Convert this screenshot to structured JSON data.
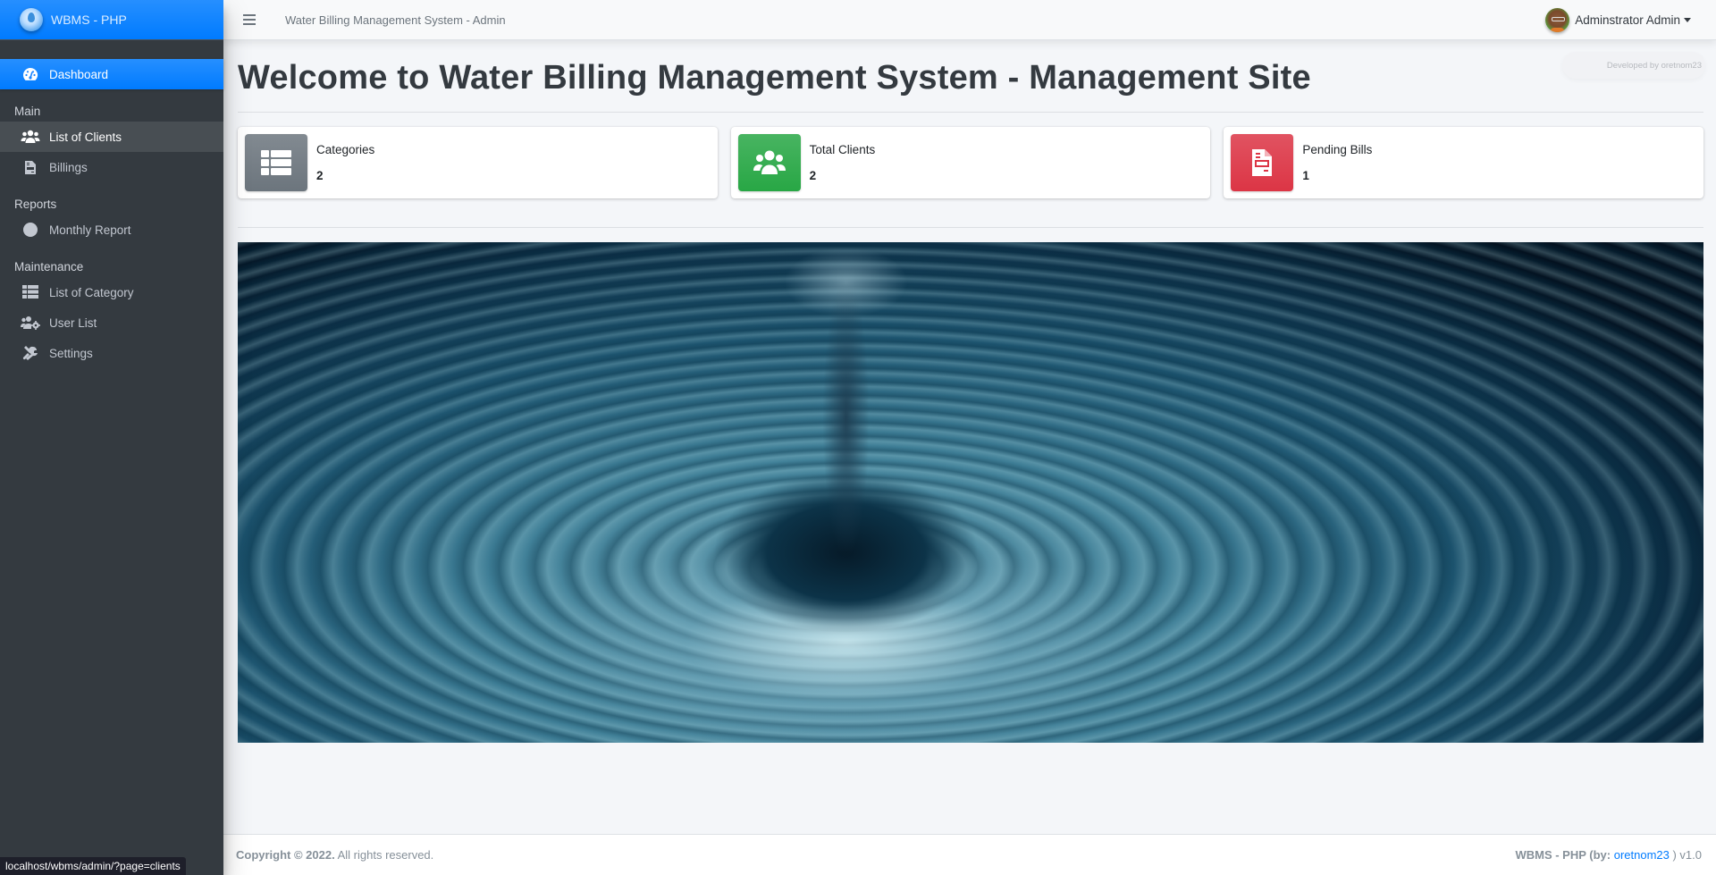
{
  "brand": {
    "name": "WBMS - PHP",
    "logo_icon": "water-drop-logo"
  },
  "sidebar": {
    "items": [
      {
        "label": "Dashboard",
        "icon": "dashboard-gauge-icon",
        "active": true
      },
      {
        "header": "Main"
      },
      {
        "label": "List of Clients",
        "icon": "users-icon",
        "hovered": true
      },
      {
        "label": "Billings",
        "icon": "file-invoice-icon"
      },
      {
        "header": "Reports"
      },
      {
        "label": "Monthly Report",
        "icon": "circle-icon"
      },
      {
        "header": "Maintenance"
      },
      {
        "label": "List of Category",
        "icon": "table-list-icon"
      },
      {
        "label": "User List",
        "icon": "users-cog-icon"
      },
      {
        "label": "Settings",
        "icon": "tools-icon"
      }
    ]
  },
  "topbar": {
    "menu_icon": "hamburger-icon",
    "site_title": "Water Billing Management System - Admin",
    "user_name": "Adminstrator Admin"
  },
  "dev_badge": "Developed by oretnom23",
  "page": {
    "title": "Welcome to Water Billing Management System - Management Site"
  },
  "info_boxes": [
    {
      "label": "Categories",
      "value": "2",
      "icon": "table-list-icon",
      "color": "#6c757d"
    },
    {
      "label": "Total Clients",
      "value": "2",
      "icon": "users-icon",
      "color": "#28a745"
    },
    {
      "label": "Pending Bills",
      "value": "1",
      "icon": "file-invoice-icon",
      "color": "#dc3545"
    }
  ],
  "hero_image": {
    "alt": "water drop ripple"
  },
  "footer": {
    "copyright": "Copyright © 2022.",
    "rights": " All rights reserved.",
    "app": "WBMS - PHP (by: ",
    "author": "oretnom23",
    "version": " ) v1.0"
  },
  "statusbar": {
    "url": "localhost/wbms/admin/?page=clients"
  }
}
